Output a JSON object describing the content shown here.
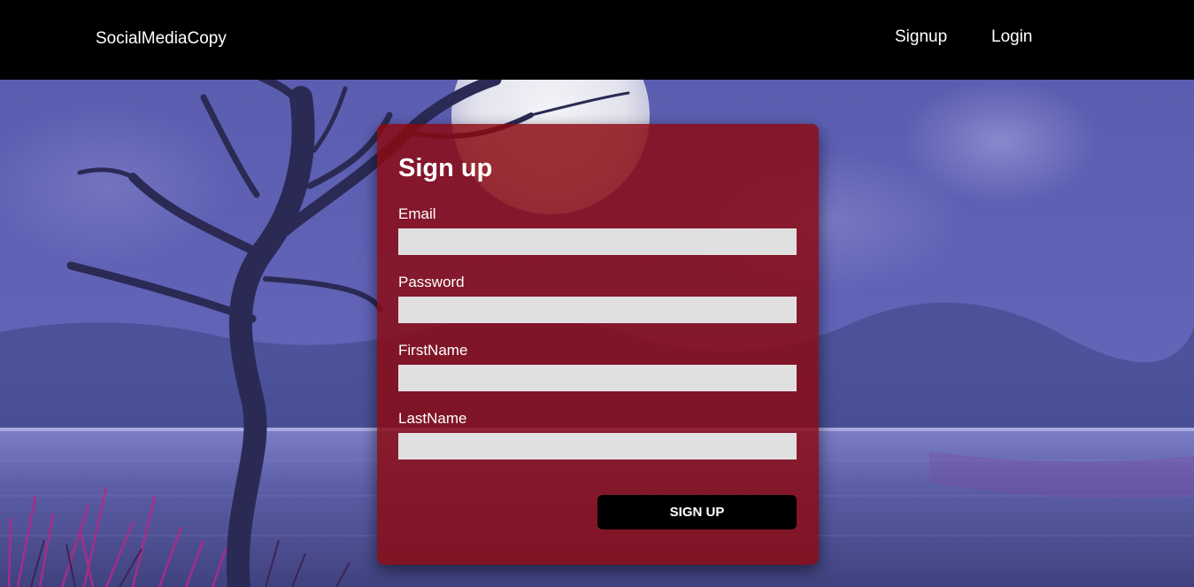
{
  "navbar": {
    "brand": "SocialMediaCopy",
    "links": [
      {
        "label": "Signup"
      },
      {
        "label": "Login"
      }
    ]
  },
  "form": {
    "title": "Sign up",
    "fields": [
      {
        "label": "Email",
        "value": "",
        "placeholder": ""
      },
      {
        "label": "Password",
        "value": "",
        "placeholder": ""
      },
      {
        "label": "FirstName",
        "value": "",
        "placeholder": ""
      },
      {
        "label": "LastName",
        "value": "",
        "placeholder": ""
      }
    ],
    "submit_label": "SIGN UP"
  },
  "colors": {
    "navbar_bg": "#000000",
    "card_bg": "#8c0a12",
    "input_bg": "#e0e0e0",
    "button_bg": "#000000",
    "text": "#ffffff"
  }
}
